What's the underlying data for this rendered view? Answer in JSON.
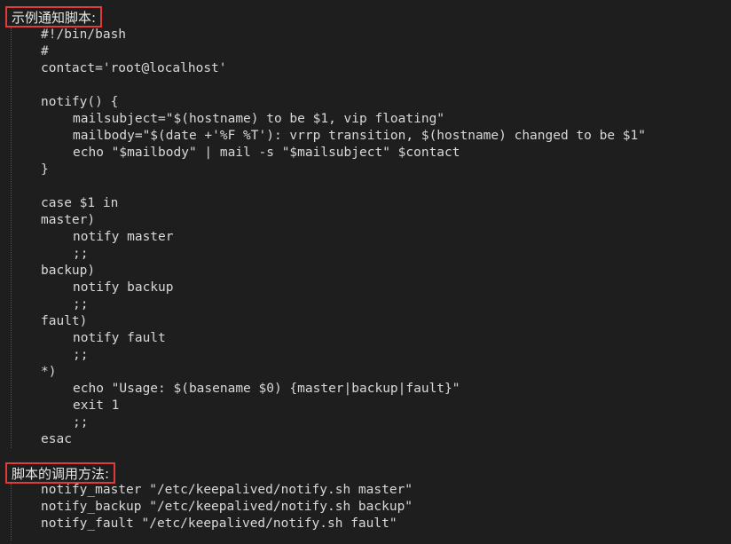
{
  "example": {
    "heading": "示例通知脚本:",
    "lines": [
      "#!/bin/bash",
      "#",
      "contact='root@localhost'",
      "",
      "notify() {",
      "mailsubject=\"$(hostname) to be $1, vip floating\"",
      "mailbody=\"$(date +'%F %T'): vrrp transition, $(hostname) changed to be $1\"",
      "echo \"$mailbody\" | mail -s \"$mailsubject\" $contact",
      "}",
      "",
      "case $1 in",
      "master)",
      "notify master",
      ";;",
      "backup)",
      "notify backup",
      ";;",
      "fault)",
      "notify fault",
      ";;",
      "*)",
      "echo \"Usage: $(basename $0) {master|backup|fault}\"",
      "exit 1",
      ";;",
      "esac"
    ]
  },
  "usage": {
    "heading": "脚本的调用方法:",
    "lines": [
      "notify_master \"/etc/keepalived/notify.sh master\"",
      "notify_backup \"/etc/keepalived/notify.sh backup\"",
      "notify_fault \"/etc/keepalived/notify.sh fault\""
    ]
  }
}
